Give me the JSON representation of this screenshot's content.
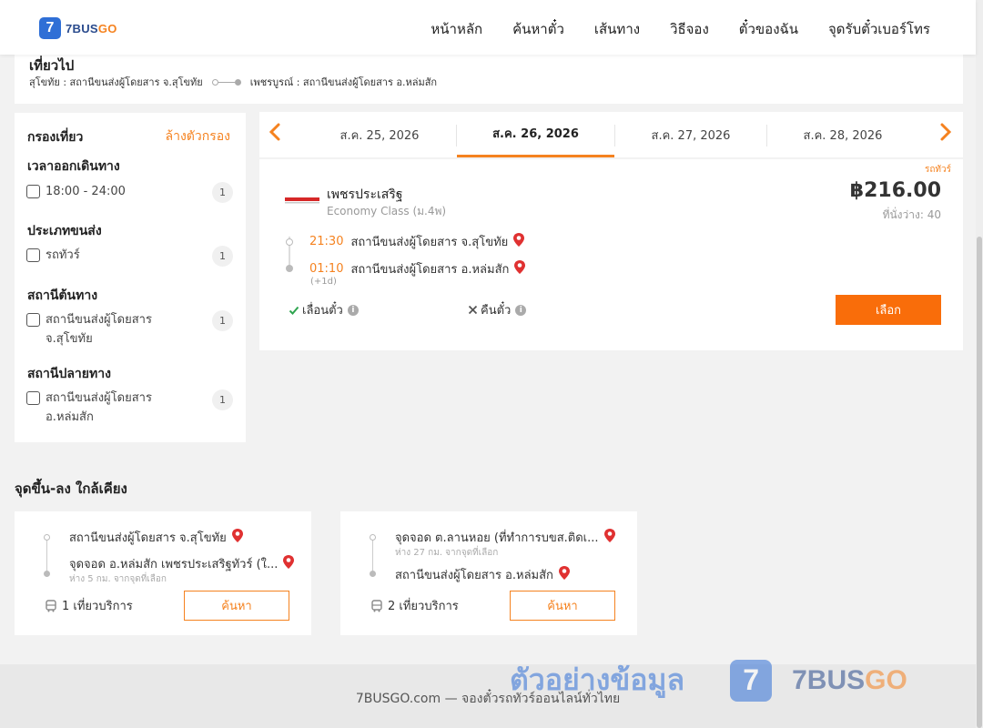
{
  "header": {
    "logo_number": "7",
    "logo_brand": "7BUS",
    "logo_brand_go": "GO",
    "nav": [
      "หน้าหลัก",
      "ค้นหาตั๋ว",
      "เส้นทาง",
      "วิธีจอง",
      "ตั๋วของฉัน",
      "จุดรับตั๋วเบอร์โทร"
    ]
  },
  "trip": {
    "title": "เที่ยวไป",
    "origin": "สุโขทัย : สถานีขนส่งผู้โดยสาร จ.สุโขทัย",
    "destination": "เพชรบูรณ์ : สถานีขนส่งผู้โดยสาร อ.หล่มสัก"
  },
  "filter": {
    "title": "กรองเที่ยว",
    "clear": "ล้างตัวกรอง",
    "groups": [
      {
        "title": "เวลาออกเดินทาง",
        "options": [
          {
            "label": "18:00 - 24:00",
            "count": "1"
          }
        ]
      },
      {
        "title": "ประเภทขนส่ง",
        "options": [
          {
            "label": "รถทัวร์",
            "count": "1"
          }
        ]
      },
      {
        "title": "สถานีต้นทาง",
        "options": [
          {
            "label": "สถานีขนส่งผู้โดยสาร จ.สุโขทัย",
            "count": "1"
          }
        ]
      },
      {
        "title": "สถานีปลายทาง",
        "options": [
          {
            "label": "สถานีขนส่งผู้โดยสาร อ.หล่มสัก",
            "count": "1"
          }
        ]
      }
    ]
  },
  "dates": {
    "prev_icon": "chevron-left",
    "next_icon": "chevron-right",
    "tabs": [
      "ส.ค. 25, 2026",
      "ส.ค. 26, 2026",
      "ส.ค. 27, 2026",
      "ส.ค. 28, 2026"
    ],
    "active_index": 1
  },
  "result": {
    "tag": "รถทัวร์",
    "operator": "เพชรประเสริฐ",
    "class": "Economy Class (ม.4พ)",
    "price": "฿216.00",
    "seats": "ที่นั่งว่าง: 40",
    "depart_time": "21:30",
    "depart_station": "สถานีขนส่งผู้โดยสาร จ.สุโขทัย",
    "arrive_time": "01:10",
    "arrive_station": "สถานีขนส่งผู้โดยสาร อ.หล่มสัก",
    "day_plus": "(+1d)",
    "postpone": "เลื่อนตั๋ว",
    "refund": "คืนตั๋ว",
    "select": "เลือก"
  },
  "nearby": {
    "title": "จุดขึ้น-ลง ใกล้เคียง",
    "cards": [
      {
        "stop1": "สถานีขนส่งผู้โดยสาร จ.สุโขทัย",
        "stop2": "จุดจอด อ.หล่มสัก เพชรประเสริฐทัวร์ (ใ...",
        "distance": "ห่าง 5 กม. จากจุดที่เลือก",
        "trips": "1 เที่ยวบริการ",
        "button": "ค้นหา"
      },
      {
        "stop1": "จุดจอด ต.ลานหอย (ที่ทำการบขส.ติดเ...",
        "distance": "ห่าง 27 กม. จากจุดที่เลือก",
        "stop2": "สถานีขนส่งผู้โดยสาร อ.หล่มสัก",
        "trips": "2 เที่ยวบริการ",
        "button": "ค้นหา"
      }
    ]
  },
  "footer": {
    "text": "7BUSGO.com — จองตั๋วรถทัวร์ออนไลน์ทั่วไทย"
  },
  "watermark": {
    "text": "ตัวอย่างข้อมูล",
    "logo_number": "7",
    "brand": "7BUS",
    "brand_go": "GO"
  },
  "colors": {
    "accent": "#f5821f",
    "button": "#f96d0a",
    "brand_blue": "#2f6fd6",
    "pin_red": "#e03131"
  }
}
